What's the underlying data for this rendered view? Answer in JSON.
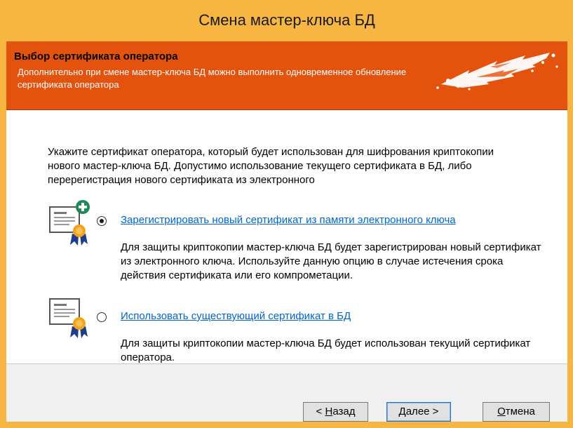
{
  "window": {
    "title": "Смена мастер-ключа БД"
  },
  "banner": {
    "title": "Выбор сертификата оператора",
    "description": "Дополнительно при смене мастер-ключа БД можно выполнить одновременное обновление сертификата оператора"
  },
  "content": {
    "intro": "Укажите сертификат оператора, который будет использован для шифрования криптокопии нового мастер-ключа БД. Допустимо использование текущего сертификата в БД, либо перерегистрация нового сертификата из электронного",
    "options": [
      {
        "label": "Зарегистрировать новый сертификат из памяти электронного ключа",
        "selected": true,
        "icon": "certificate-add-icon",
        "description": "Для защиты криптокопии мастер-ключа БД будет зарегистрирован новый сертификат из электронного ключа. Используйте данную опцию в случае истечения срока действия сертификата или его компрометации."
      },
      {
        "label": "Использовать существующий сертификат в БД",
        "selected": false,
        "icon": "certificate-icon",
        "description": "Для защиты криптокопии мастер-ключа БД будет использован текущий сертификат оператора."
      }
    ]
  },
  "buttons": {
    "back": {
      "prefix": "< ",
      "mnemonic": "Н",
      "rest": "азад"
    },
    "next": {
      "mnemonic": "Д",
      "rest": "алее >"
    },
    "cancel": {
      "mnemonic": "О",
      "rest": "тмена"
    }
  },
  "colors": {
    "title_bar": "#f7b642",
    "banner": "#e4530e",
    "link": "#0066cc",
    "cert_plus": "#1e8a5a",
    "seal": "#f4a21a",
    "ribbon": "#1f3d8a"
  }
}
